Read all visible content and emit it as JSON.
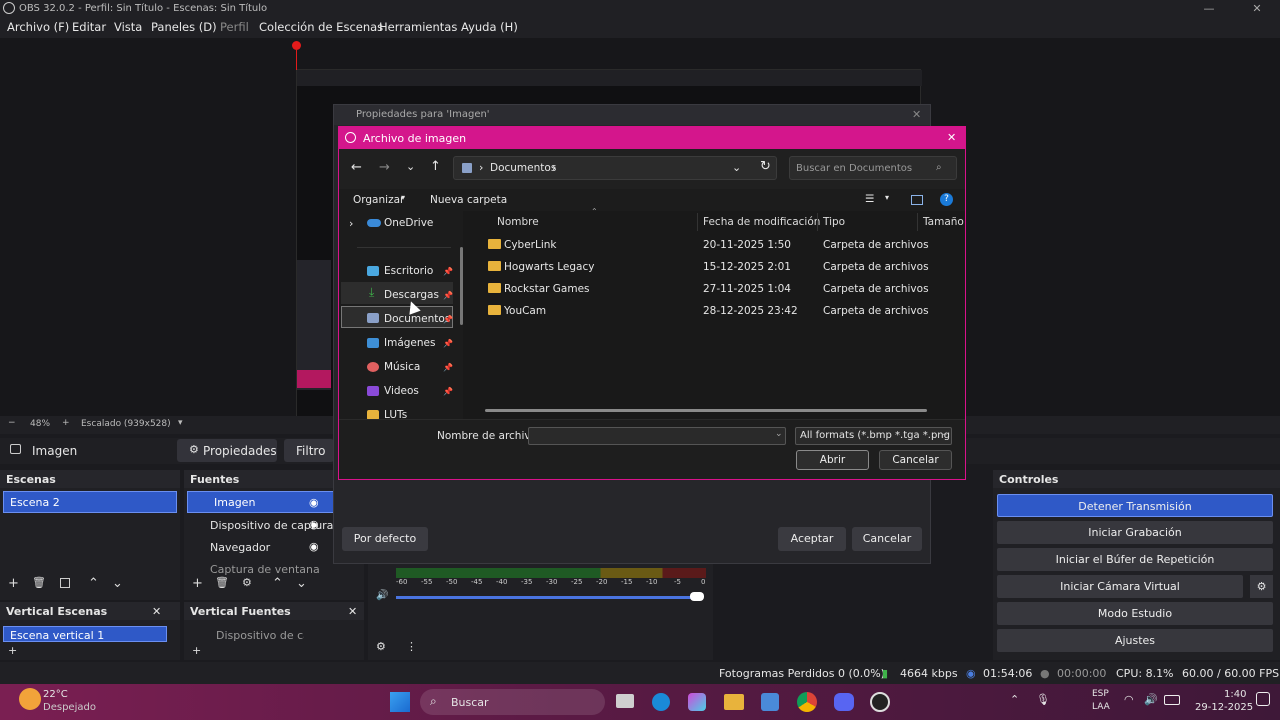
{
  "window": {
    "title": "OBS 32.0.2 - Perfil: Sin Título - Escenas: Sin Título"
  },
  "menu": [
    "Archivo (F)",
    "Editar",
    "Vista",
    "Paneles (D)",
    "Perfil",
    "Colección de Escenas",
    "Herramientas",
    "Ayuda (H)"
  ],
  "zoom": {
    "minus": "−",
    "level": "48%",
    "plus": "+",
    "scaling": "Escalado (939x528)"
  },
  "source_bar": {
    "source": "Imagen",
    "properties": "Propiedades",
    "filters": "Filtro"
  },
  "scenes": {
    "title": "Escenas",
    "items": [
      "Escena 2"
    ]
  },
  "sources": {
    "title": "Fuentes",
    "items": [
      "Imagen",
      "Dispositivo de captura de vídeo",
      "Navegador",
      "Captura de ventana"
    ]
  },
  "vertical_scenes": {
    "title": "Vertical Escenas",
    "items": [
      "Escena vertical 1"
    ]
  },
  "vertical_sources": {
    "title": "Vertical Fuentes",
    "items": [
      "Dispositivo de captura"
    ]
  },
  "controls": {
    "title": "Controles",
    "buttons": [
      "Detener Transmisión",
      "Iniciar Grabación",
      "Iniciar el Búfer de Repetición",
      "Iniciar Cámara Virtual",
      "Modo Estudio",
      "Ajustes"
    ]
  },
  "mixer": {
    "ticks": [
      "-60",
      "-55",
      "-50",
      "-45",
      "-40",
      "-35",
      "-30",
      "-25",
      "-20",
      "-15",
      "-10",
      "-5",
      "0"
    ]
  },
  "status": {
    "dropped": "Fotogramas Perdidos 0 (0.0%)",
    "bitrate": "4664 kbps",
    "stream_time": "01:54:06",
    "rec_time": "00:00:00",
    "cpu": "CPU: 8.1%",
    "fps": "60.00 / 60.00 FPS"
  },
  "properties_dialog": {
    "title": "Propiedades para 'Imagen'",
    "defaults": "Por defecto",
    "accept": "Aceptar",
    "cancel": "Cancelar"
  },
  "file_dialog": {
    "title": "Archivo de imagen",
    "path": "Documentos",
    "search_placeholder": "Buscar en Documentos",
    "organize": "Organizar",
    "new_folder": "Nueva carpeta",
    "nav": [
      "OneDrive",
      "Escritorio",
      "Descargas",
      "Documentos",
      "Imágenes",
      "Música",
      "Videos",
      "LUTs"
    ],
    "columns": [
      "Nombre",
      "Fecha de modificación",
      "Tipo",
      "Tamaño"
    ],
    "files": [
      {
        "name": "CyberLink",
        "date": "20-11-2025 1:50",
        "type": "Carpeta de archivos"
      },
      {
        "name": "Hogwarts Legacy",
        "date": "15-12-2025 2:01",
        "type": "Carpeta de archivos"
      },
      {
        "name": "Rockstar Games",
        "date": "27-11-2025 1:04",
        "type": "Carpeta de archivos"
      },
      {
        "name": "YouCam",
        "date": "28-12-2025 23:42",
        "type": "Carpeta de archivos"
      }
    ],
    "filename_label": "Nombre de archivo:",
    "filename_value": "",
    "filter": "All formats (*.bmp *.tga *.png *",
    "open": "Abrir",
    "cancel": "Cancelar"
  },
  "taskbar": {
    "weather_temp": "22°C",
    "weather_desc": "Despejado",
    "search": "Buscar",
    "lang_top": "ESP",
    "lang_bottom": "LAA",
    "time": "1:40",
    "date": "29-12-2025"
  }
}
